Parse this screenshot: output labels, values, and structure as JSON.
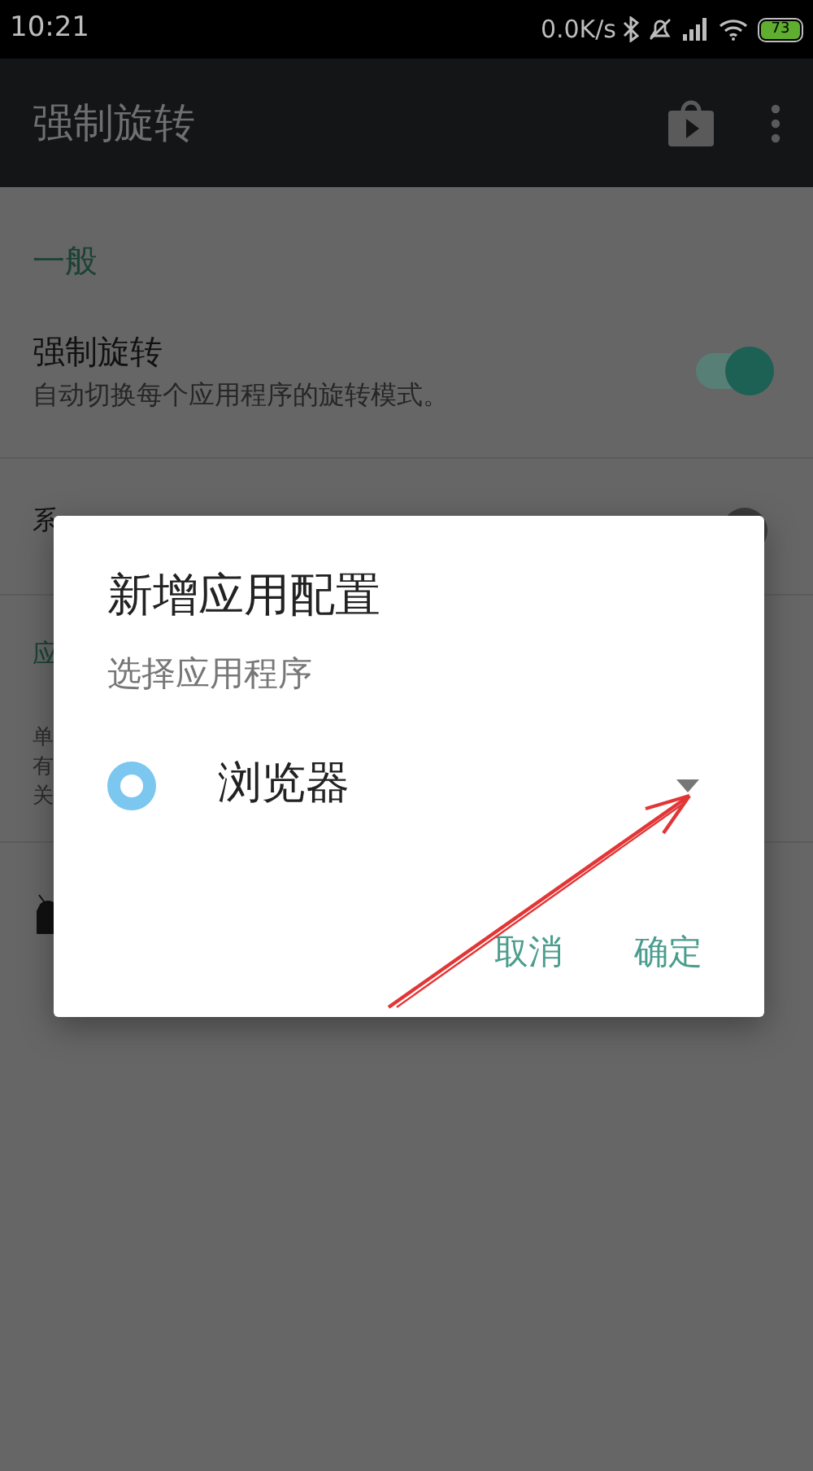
{
  "status_bar": {
    "time": "10:21",
    "net_speed": "0.0K/s",
    "battery": "73"
  },
  "app_bar": {
    "title": "强制旋转"
  },
  "section_header": "一般",
  "settings": [
    {
      "title": "强制旋转",
      "subtitle": "自动切换每个应用程序的旋转模式。",
      "on": true
    }
  ],
  "obscured": {
    "row_title": "系",
    "row_on": false,
    "section_header": "应",
    "row_lines": [
      "单",
      "有",
      "关"
    ]
  },
  "dialog": {
    "title": "新增应用配置",
    "label": "选择应用程序",
    "selected_app": "浏览器",
    "buttons": [
      "取消",
      "确定"
    ]
  }
}
